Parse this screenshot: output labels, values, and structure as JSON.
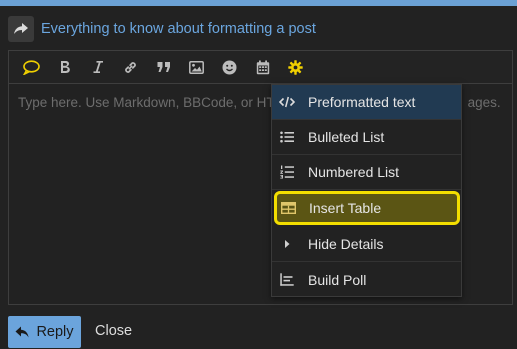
{
  "reply_header": {
    "topic_title": "Everything to know about formatting a post",
    "share_icon": "share-arrow-icon"
  },
  "toolbar": {
    "buttons": [
      {
        "icon": "speech-bubble-icon"
      },
      {
        "icon": "bold-icon"
      },
      {
        "icon": "italic-icon"
      },
      {
        "icon": "link-icon"
      },
      {
        "icon": "blockquote-icon"
      },
      {
        "icon": "image-icon"
      },
      {
        "icon": "emoji-icon"
      },
      {
        "icon": "calendar-icon"
      },
      {
        "icon": "gear-icon",
        "color": "#f0d000"
      }
    ]
  },
  "editor": {
    "placeholder_visible": "Type here. Use Markdown, BBCode, or HT",
    "placeholder_tail": "ages."
  },
  "options_menu": {
    "items": [
      {
        "label": "Preformatted text",
        "icon": "code-icon",
        "state": "selected"
      },
      {
        "label": "Bulleted List",
        "icon": "bulleted-list-icon"
      },
      {
        "label": "Numbered List",
        "icon": "numbered-list-icon"
      },
      {
        "label": "Insert Table",
        "icon": "table-icon",
        "state": "highlighted"
      },
      {
        "label": "Hide Details",
        "icon": "caret-right-icon"
      },
      {
        "label": "Build Poll",
        "icon": "chart-icon"
      }
    ]
  },
  "footer": {
    "reply_label": "Reply",
    "close_label": "Close"
  },
  "colors": {
    "accent": "#6ba4dc",
    "highlight_border": "#f3de00",
    "highlight_fill": "#5b5514",
    "selected_fill": "#213a52",
    "background": "#222222"
  }
}
